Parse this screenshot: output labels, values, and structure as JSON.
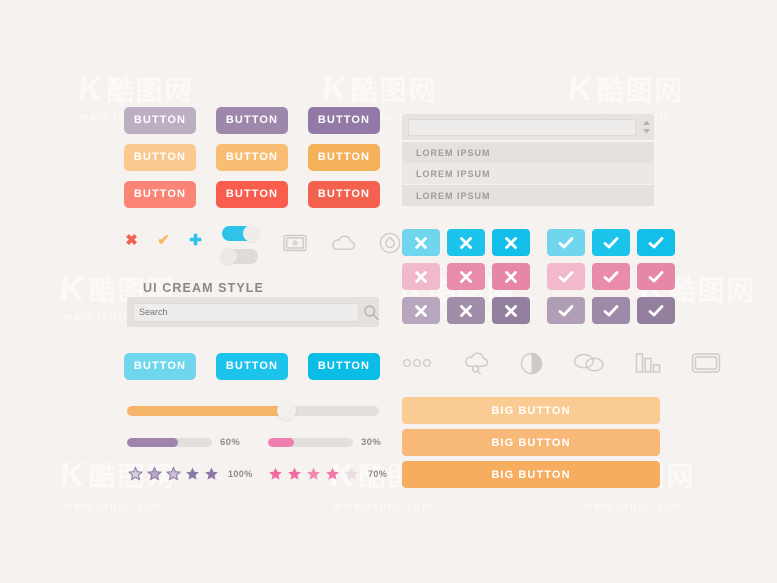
{
  "canvas": {
    "background": "#f6f2ef",
    "title": "UI CREAM STYLE"
  },
  "watermarks": {
    "logo_k": "K",
    "logo_cjk": "酷图网",
    "url": "www.ikutu.com",
    "url_short": "tu.com"
  },
  "buttons": {
    "label": "BUTTON",
    "rows": [
      {
        "name": "purple-row",
        "colors": [
          "#bcafc4",
          "#9d87ab",
          "#9379a6"
        ]
      },
      {
        "name": "orange-row",
        "colors": [
          "#fac98f",
          "#f9bd74",
          "#f6b25b"
        ]
      },
      {
        "name": "red-row",
        "colors": [
          "#fa8577",
          "#f95d4e",
          "#f4624f"
        ]
      }
    ],
    "cyan_row": {
      "name": "cyan-row",
      "colors": [
        "#6fd6ee",
        "#1cc3ea",
        "#09bde6"
      ]
    }
  },
  "big_buttons": {
    "label": "BIG BUTTON",
    "colors": [
      "#fbcb94",
      "#f8b978",
      "#f6ad5f"
    ]
  },
  "mini_icons": [
    {
      "name": "cross-icon",
      "glyph": "✖",
      "color": "#f4604f"
    },
    {
      "name": "check-icon",
      "glyph": "✔",
      "color": "#f8b95f"
    },
    {
      "name": "plus-icon",
      "glyph": "✚",
      "color": "#2ec4ea"
    }
  ],
  "toggles": [
    {
      "name": "toggle-on",
      "state": "on"
    },
    {
      "name": "toggle-off",
      "state": "off"
    }
  ],
  "outline_icons_left": [
    {
      "name": "money-bill-icon"
    },
    {
      "name": "cloud-icon"
    },
    {
      "name": "droplet-circle-icon"
    }
  ],
  "outline_icons_right": [
    {
      "name": "three-dots-icon"
    },
    {
      "name": "cloud-search-icon"
    },
    {
      "name": "contrast-circle-icon"
    },
    {
      "name": "chat-bubbles-icon"
    },
    {
      "name": "bar-chart-icon"
    },
    {
      "name": "window-icon"
    }
  ],
  "search": {
    "name": "search-bar",
    "placeholder": "Search",
    "value": "",
    "icon": "search-icon"
  },
  "dropdown": {
    "name": "number-spinner",
    "value": "",
    "placeholder": "",
    "spinner_icon": "spinner-up-down-icon"
  },
  "list": {
    "items": [
      "LOREM IPSUM",
      "LOREM IPSUM",
      "LOREM IPSUM"
    ]
  },
  "check_cross_grid": {
    "rows": [
      {
        "name": "cyan-row",
        "cross_colors": [
          "#6fd6ee",
          "#1cc3ea",
          "#12bfe8"
        ],
        "check_colors": [
          "#6fd6ee",
          "#1cc3ea",
          "#12bfe8"
        ]
      },
      {
        "name": "pink-row",
        "cross_colors": [
          "#f2b9cd",
          "#e98bab",
          "#e687a8"
        ],
        "check_colors": [
          "#f2b9cd",
          "#e98bab",
          "#e687a8"
        ]
      },
      {
        "name": "purple-row",
        "cross_colors": [
          "#b7a6bd",
          "#9f8daa",
          "#93809f"
        ],
        "check_colors": [
          "#b09eb6",
          "#9d8aa8",
          "#93809f"
        ]
      }
    ],
    "cross_glyph": "✖",
    "check_glyph": "✔"
  },
  "slider": {
    "name": "orange-slider",
    "percent": 63,
    "fill_color": "#f6b469",
    "track_color": "#e2dfdd"
  },
  "progress_bars": [
    {
      "name": "progress-purple",
      "label": "60%",
      "percent": 60,
      "color": "#9d85ad"
    },
    {
      "name": "progress-pink",
      "label": "30%",
      "percent": 30,
      "color": "#ef7fae"
    }
  ],
  "star_ratings": [
    {
      "name": "rating-purple",
      "label": "100%",
      "filled": 5,
      "total": 5,
      "color": "#8b77a3",
      "empty_color": "#d8cfdd",
      "label_color": "#8e8a86"
    },
    {
      "name": "rating-pink",
      "label": "70%",
      "filled": 4,
      "total": 5,
      "color": "#ef6ba2",
      "empty_color": "#e9d6df",
      "label_color": "#8e8a86"
    }
  ]
}
